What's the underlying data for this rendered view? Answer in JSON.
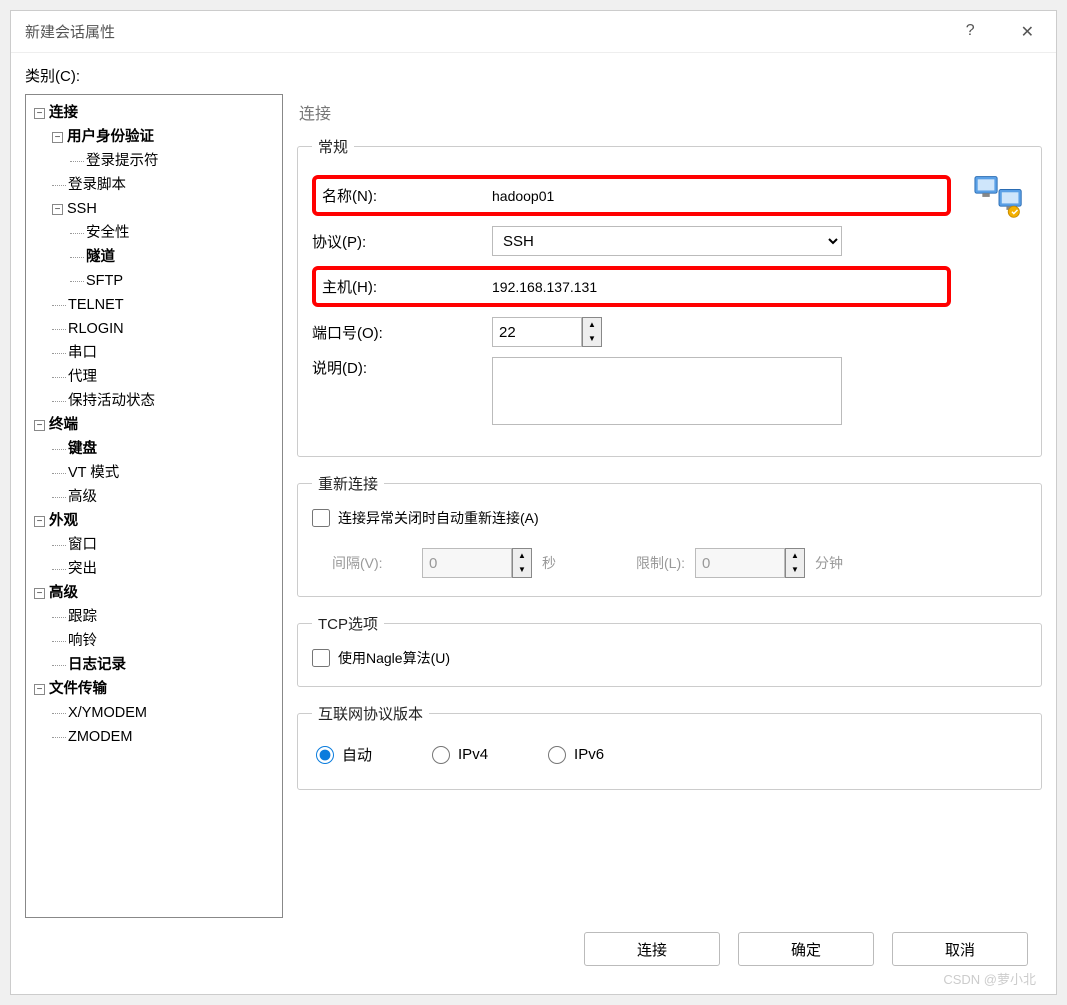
{
  "title": "新建会话属性",
  "category_label": "类别(C):",
  "tree": {
    "connection": "连接",
    "user_auth": "用户身份验证",
    "login_prompt": "登录提示符",
    "login_script": "登录脚本",
    "ssh": "SSH",
    "security": "安全性",
    "tunnel": "隧道",
    "sftp": "SFTP",
    "telnet": "TELNET",
    "rlogin": "RLOGIN",
    "serial": "串口",
    "proxy": "代理",
    "keepalive": "保持活动状态",
    "terminal": "终端",
    "keyboard": "键盘",
    "vtmode": "VT 模式",
    "advanced_t": "高级",
    "appearance": "外观",
    "window": "窗口",
    "highlight": "突出",
    "advanced": "高级",
    "trace": "跟踪",
    "bell": "响铃",
    "logging": "日志记录",
    "file_transfer": "文件传输",
    "xymodem": "X/YMODEM",
    "zmodem": "ZMODEM"
  },
  "panel_title": "连接",
  "general": {
    "legend": "常规",
    "name_label": "名称(N):",
    "name_value": "hadoop01",
    "protocol_label": "协议(P):",
    "protocol_value": "SSH",
    "host_label": "主机(H):",
    "host_value": "192.168.137.131",
    "port_label": "端口号(O):",
    "port_value": "22",
    "desc_label": "说明(D):"
  },
  "reconnect": {
    "legend": "重新连接",
    "auto_label": "连接异常关闭时自动重新连接(A)",
    "interval_label": "间隔(V):",
    "interval_value": "0",
    "sec": "秒",
    "limit_label": "限制(L):",
    "limit_value": "0",
    "min": "分钟"
  },
  "tcp": {
    "legend": "TCP选项",
    "nagle_label": "使用Nagle算法(U)"
  },
  "ipver": {
    "legend": "互联网协议版本",
    "auto": "自动",
    "ipv4": "IPv4",
    "ipv6": "IPv6"
  },
  "buttons": {
    "connect": "连接",
    "ok": "确定",
    "cancel": "取消"
  },
  "watermark": "CSDN @萝小北"
}
